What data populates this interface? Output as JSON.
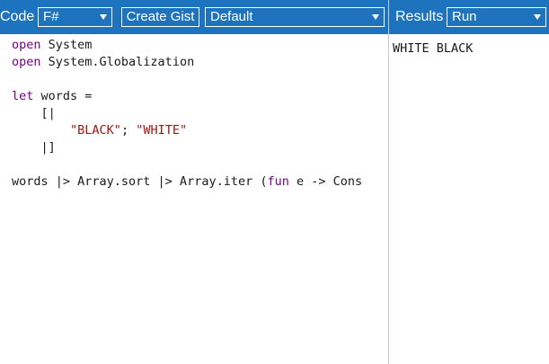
{
  "toolbar_left": {
    "code_label": "Code",
    "language": "F#",
    "create_gist": "Create Gist",
    "theme": "Default"
  },
  "toolbar_right": {
    "results_label": "Results",
    "run": "Run"
  },
  "editor": {
    "lines": [
      [
        {
          "t": "open",
          "c": "kw"
        },
        {
          "t": " System",
          "c": ""
        }
      ],
      [
        {
          "t": "open",
          "c": "kw"
        },
        {
          "t": " System.Globalization",
          "c": ""
        }
      ],
      [],
      [
        {
          "t": "let",
          "c": "kw"
        },
        {
          "t": " words =",
          "c": ""
        }
      ],
      [
        {
          "t": "    [|",
          "c": ""
        }
      ],
      [
        {
          "t": "        ",
          "c": ""
        },
        {
          "t": "\"BLACK\"",
          "c": "str"
        },
        {
          "t": "; ",
          "c": ""
        },
        {
          "t": "\"WHITE\"",
          "c": "str"
        }
      ],
      [
        {
          "t": "    |]",
          "c": ""
        }
      ],
      [],
      [
        {
          "t": "words |> Array.sort |> Array.iter (",
          "c": ""
        },
        {
          "t": "fun",
          "c": "kw"
        },
        {
          "t": " e -> Cons",
          "c": ""
        }
      ]
    ]
  },
  "results": {
    "output": "WHITE BLACK"
  },
  "colors": {
    "toolbar": "#1e73be",
    "keyword": "#770088",
    "string": "#aa1111"
  }
}
